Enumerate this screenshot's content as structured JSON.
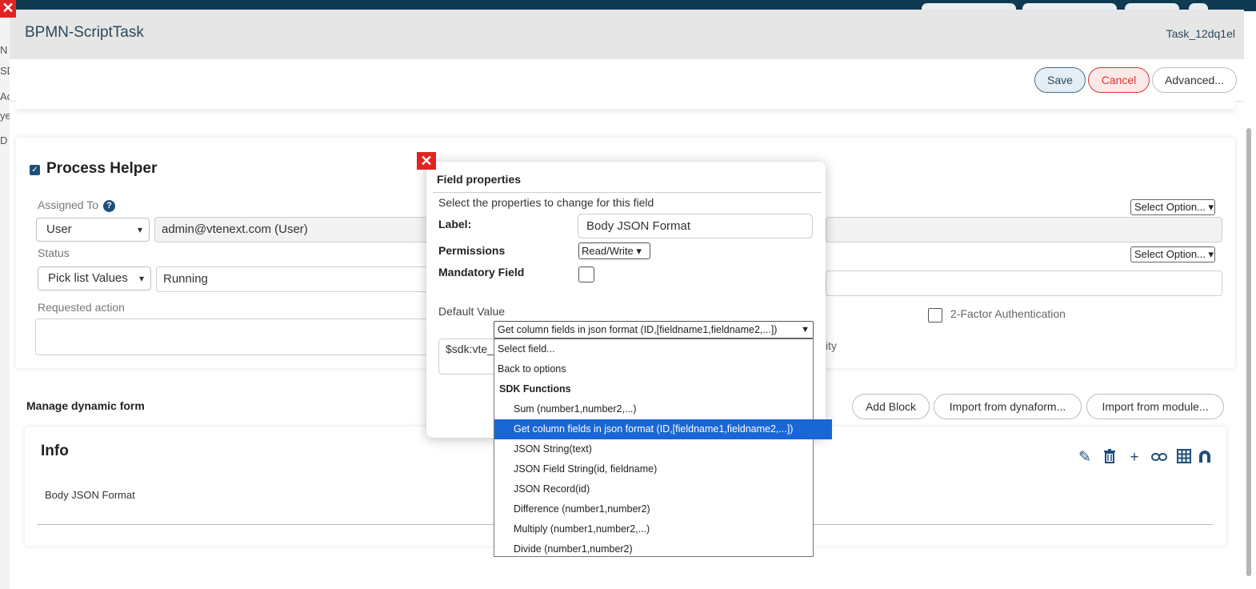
{
  "dialog": {
    "title": "BPMN-ScriptTask",
    "task_id": "Task_12dq1el",
    "close_glyph": "✕"
  },
  "toolbar": {
    "save_label": "Save",
    "cancel_label": "Cancel",
    "advanced_label": "Advanced..."
  },
  "background_left": [
    "N",
    "SD",
    "Ac",
    "ye",
    "D"
  ],
  "process_helper": {
    "title": "Process Helper",
    "assigned_to_label": "Assigned To",
    "assigned_type": "User",
    "assigned_value": "admin@vtenext.com (User)",
    "status_label": "Status",
    "status_type": "Pick list Values",
    "status_value": "Running",
    "requested_action_label": "Requested action",
    "select_option_1": "Select Option...",
    "select_option_2": "Select Option...",
    "twofa_label": "2-Factor Authentication",
    "partial_text": "ity"
  },
  "manage_dynamic_form": {
    "title": "Manage dynamic form",
    "add_block_label": "Add Block",
    "import_dynaform_label": "Import from dynaform...",
    "import_module_label": "Import from module..."
  },
  "info_block": {
    "title": "Info",
    "field_label": "Body JSON Format",
    "icons": [
      "pencil-icon",
      "trash-icon",
      "plus-icon",
      "link-icon",
      "table-icon",
      "magnet-icon"
    ]
  },
  "field_properties": {
    "title": "Field properties",
    "subtitle": "Select the properties to change for this field",
    "label_label": "Label:",
    "label_value": "Body JSON Format",
    "permissions_label": "Permissions",
    "permissions_value": "Read/Write",
    "mandatory_label": "Mandatory Field",
    "default_value_label": "Default Value",
    "default_value_text": "$sdk:vte_",
    "dropdown_selected": "Get column fields in json format (ID,[fieldname1,fieldname2,...])",
    "dropdown_options": [
      {
        "label": "Select field...",
        "level": 1
      },
      {
        "label": "Back to options",
        "level": 1
      },
      {
        "label": "SDK Functions",
        "level": 0
      },
      {
        "label": "Sum (number1,number2,...)",
        "level": 2
      },
      {
        "label": "Get column fields in json format (ID,[fieldname1,fieldname2,...])",
        "level": 2,
        "highlighted": true
      },
      {
        "label": "JSON String(text)",
        "level": 2
      },
      {
        "label": "JSON Field String(id, fieldname)",
        "level": 2
      },
      {
        "label": "JSON Record(id)",
        "level": 2
      },
      {
        "label": "Difference (number1,number2)",
        "level": 2
      },
      {
        "label": "Multiply (number1,number2,...)",
        "level": 2
      },
      {
        "label": "Divide (number1,number2)",
        "level": 2
      }
    ]
  },
  "colors": {
    "accent": "#1e4f7a",
    "cancel_red": "#dd3333",
    "highlight_blue": "#1a66d6",
    "header_grey": "#e6e6e6"
  }
}
